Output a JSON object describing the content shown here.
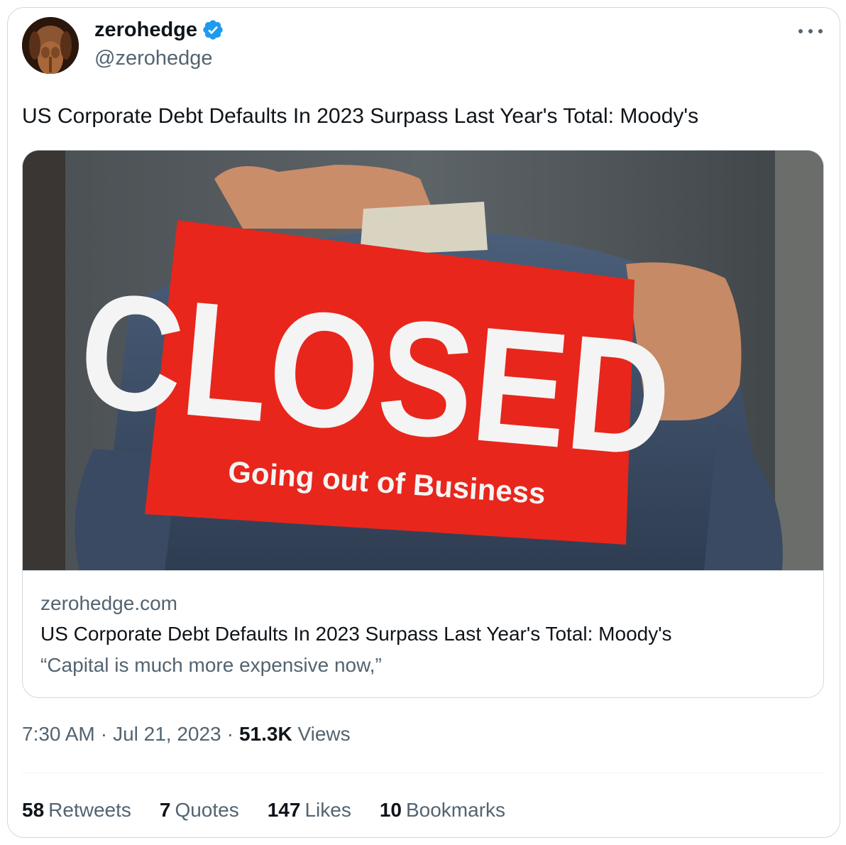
{
  "author": {
    "name": "zerohedge",
    "handle": "@zerohedge",
    "verified": true
  },
  "tweet": {
    "text": "US Corporate Debt Defaults In 2023 Surpass Last Year's Total: Moody's"
  },
  "link_card": {
    "domain": "zerohedge.com",
    "title": "US Corporate Debt Defaults In 2023 Surpass Last Year's Total: Moody's",
    "description": "“Capital is much more expensive now,”",
    "image_sign": {
      "main_text": "CLOSED",
      "sub_text": "Going out of Business"
    }
  },
  "meta": {
    "time": "7:30 AM",
    "date": "Jul 21, 2023",
    "views_count": "51.3K",
    "views_label": "Views"
  },
  "stats": [
    {
      "count": "58",
      "label": "Retweets"
    },
    {
      "count": "7",
      "label": "Quotes"
    },
    {
      "count": "147",
      "label": "Likes"
    },
    {
      "count": "10",
      "label": "Bookmarks"
    }
  ],
  "colors": {
    "text_primary": "#0f1419",
    "text_secondary": "#536471",
    "border": "#cfd9de",
    "verified": "#1d9bf0",
    "sign_red": "#e8261c"
  },
  "icons": {
    "verified": "verified-badge-icon",
    "more": "more-options-icon"
  }
}
